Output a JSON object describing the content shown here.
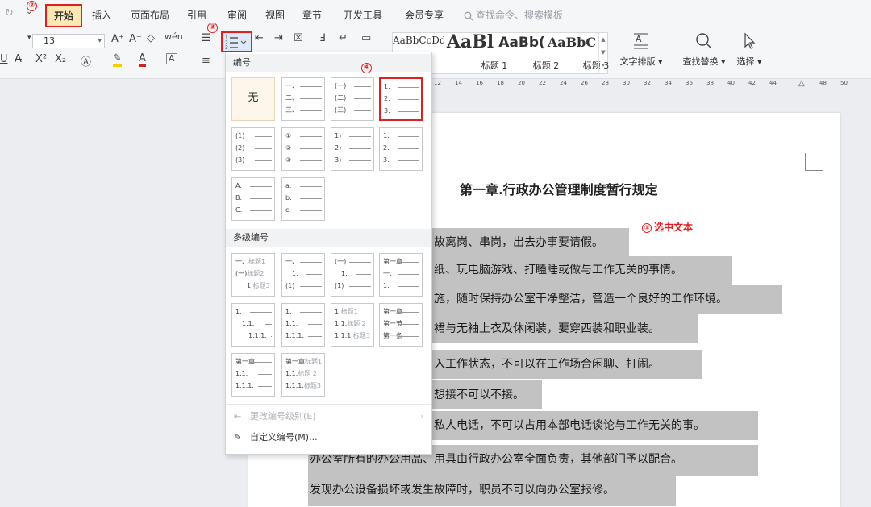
{
  "menubar": {
    "tabs": [
      {
        "label": "开始",
        "name": "tab-home"
      },
      {
        "label": "插入",
        "name": "tab-insert"
      },
      {
        "label": "页面布局",
        "name": "tab-page-layout"
      },
      {
        "label": "引用",
        "name": "tab-references"
      },
      {
        "label": "审阅",
        "name": "tab-review"
      },
      {
        "label": "视图",
        "name": "tab-view"
      },
      {
        "label": "章节",
        "name": "tab-sections"
      },
      {
        "label": "开发工具",
        "name": "tab-developer"
      },
      {
        "label": "会员专享",
        "name": "tab-member"
      }
    ],
    "search_placeholder": "查找命令、搜索模板",
    "active_tab": "开始"
  },
  "ribbon": {
    "font_size": "13",
    "styles": [
      {
        "sample": "AaBbCcDd",
        "name": ""
      },
      {
        "sample": "AaBl",
        "name": "标题 1"
      },
      {
        "sample": "AaBb(",
        "name": "标题 2"
      },
      {
        "sample": "AaBbC",
        "name": "标题 3"
      }
    ],
    "buttons": {
      "text_layout": "文字排版",
      "find_replace": "查找替换",
      "select": "选择"
    }
  },
  "annotations": {
    "step1": "①",
    "step1_text": "选中文本",
    "step2": "②",
    "step3": "③",
    "step4": "④"
  },
  "ruler": {
    "labels": [
      "12",
      "14",
      "16",
      "18",
      "20",
      "22",
      "24",
      "26",
      "28",
      "30",
      "32",
      "34",
      "36",
      "38",
      "40",
      "42",
      "44",
      "48",
      "50"
    ]
  },
  "document": {
    "title": "第一章.行政办公管理制度暂行规定",
    "lines": [
      "故离岗、串岗，出去办事要请假。",
      "纸、玩电脑游戏、打瞌睡或做与工作无关的事情。",
      "施，随时保持办公室干净整洁，营造一个良好的工作环境。",
      "裙与无袖上衣及休闲装，要穿西装和职业装。",
      "入工作状态，不可以在工作场合闲聊、打闹。",
      "想接不可以不接。",
      "私人电话，不可以占用本部电话谈论与工作无关的事。",
      "办公室所有的办公用品、用具由行政办公室全面负责，其他部门予以配合。",
      "发现办公设备损坏或发生故障时，职员不可以向办公室报修。"
    ]
  },
  "dropdown": {
    "section_numbering": "编号",
    "section_multilevel": "多级编号",
    "none_label": "无",
    "tiles": [
      [
        "一、",
        "二、",
        "三、"
      ],
      [
        "(一)",
        "(二)",
        "(三)"
      ],
      [
        "1.",
        "2.",
        "3."
      ],
      [
        "(1)",
        "(2)",
        "(3)"
      ],
      [
        "①",
        "②",
        "③"
      ],
      [
        "1)",
        "2)",
        "3)"
      ],
      [
        "1.",
        "2.",
        "3."
      ],
      [
        "A.",
        "B.",
        "C."
      ],
      [
        "a.",
        "b.",
        "c."
      ]
    ],
    "multi_tiles": [
      [
        [
          "一、",
          "标题1"
        ],
        [
          "(一)",
          "标题2"
        ],
        [
          "1.",
          "标题3"
        ]
      ],
      [
        [
          "一、",
          ""
        ],
        [
          "1.",
          ""
        ],
        [
          "(1)",
          ""
        ]
      ],
      [
        [
          "(一)",
          ""
        ],
        [
          "1.",
          ""
        ],
        [
          "(1)",
          ""
        ]
      ],
      [
        [
          "第一章",
          ""
        ],
        [
          "一、",
          ""
        ],
        [
          "1.",
          ""
        ]
      ],
      [
        [
          "1.",
          ""
        ],
        [
          "1.1.",
          ""
        ],
        [
          "1.1.1.",
          ""
        ]
      ],
      [
        [
          "1.",
          ""
        ],
        [
          "1.1.",
          ""
        ],
        [
          "1.1.1.",
          ""
        ]
      ],
      [
        [
          "1.",
          "标题1"
        ],
        [
          "1.1.",
          "标题 2"
        ],
        [
          "1.1.1.",
          "标题3"
        ]
      ],
      [
        [
          "第一章",
          ""
        ],
        [
          "第一节",
          ""
        ],
        [
          "第一条",
          ""
        ]
      ],
      [
        [
          "第一章",
          ""
        ],
        [
          "1.1.",
          ""
        ],
        [
          "1.1.1.",
          ""
        ]
      ],
      [
        [
          "第一章",
          "标题1"
        ],
        [
          "1.1.",
          "标题 2"
        ],
        [
          "1.1.1.",
          "标题3"
        ]
      ]
    ],
    "change_level": "更改编号级别(E)",
    "custom": "自定义编号(M)..."
  },
  "colors": {
    "annotation_red": "#e02020",
    "selection_gray": "#c2c2c2",
    "active_tab_bg": "#fde8b3"
  }
}
